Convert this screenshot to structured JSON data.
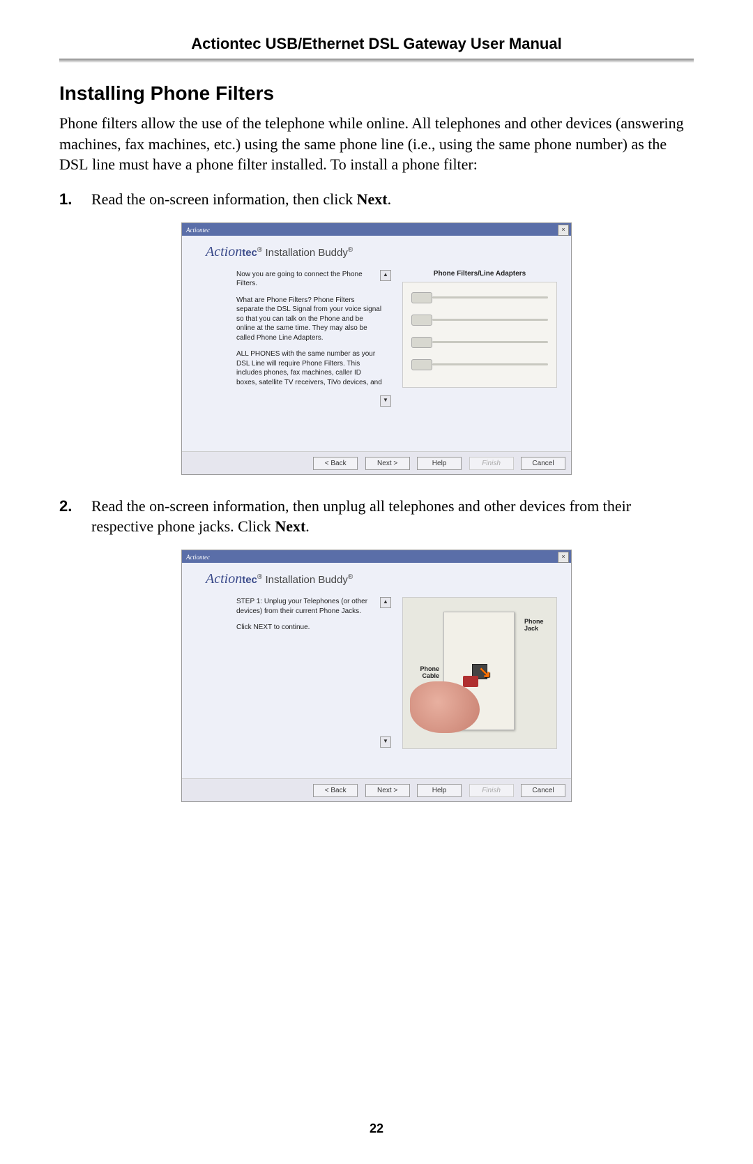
{
  "header": {
    "title": "Actiontec USB/Ethernet DSL Gateway User Manual"
  },
  "section": {
    "heading": "Installing Phone Filters",
    "intro_pre": "Phone filters allow the use of the telephone while online. All telephones and other devices (answering machines, fax machines, etc.) using the same phone line (i.e., using the same phone number) as the ",
    "intro_dsl": "DSL",
    "intro_post": " line must have a phone filter installed. To install a phone filter:"
  },
  "steps": [
    {
      "num": "1.",
      "text_pre": "Read the on-screen information, then click ",
      "bold": "Next",
      "text_post": "."
    },
    {
      "num": "2.",
      "text_pre": "Read the on-screen information, then unplug all telephones and other devices from their respective phone jacks. Click ",
      "bold": "Next",
      "text_post": "."
    }
  ],
  "installer_common": {
    "titlebar": "Actiontec",
    "close": "×",
    "brand_prefix": "Action",
    "brand_suffix": "tec",
    "brand_reg": "®",
    "brand_product": " Installation Buddy",
    "scroll_up": "▲",
    "scroll_down": "▼",
    "buttons": {
      "back": "< Back",
      "next": "Next >",
      "help": "Help",
      "finish": "Finish",
      "cancel": "Cancel"
    }
  },
  "installer1": {
    "para1": "Now you are going to connect the Phone Filters.",
    "para2": "What are Phone Filters?  Phone Filters separate the DSL Signal from your voice signal so that you can talk on the Phone and be online at the same time. They may also be called Phone Line Adapters.",
    "para3": "ALL PHONES with the same number as your DSL Line will require Phone Filters.  This includes phones, fax machines, caller ID boxes, satellite TV receivers, TiVo devices, and",
    "image_caption": "Phone Filters/Line Adapters"
  },
  "installer2": {
    "para1": "STEP 1:  Unplug your Telephones (or other devices) from their current Phone Jacks.",
    "para2": "Click NEXT to continue.",
    "label_phone_cable": "Phone Cable",
    "label_phone_jack": "Phone Jack",
    "arrow": "↘"
  },
  "page_number": "22"
}
